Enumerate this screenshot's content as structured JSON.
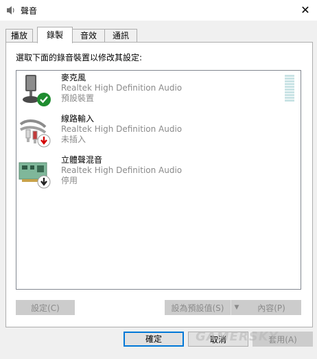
{
  "window": {
    "title": "聲音",
    "close_glyph": "✕"
  },
  "tabs": [
    {
      "label": "播放",
      "active": false
    },
    {
      "label": "錄製",
      "active": true
    },
    {
      "label": "音效",
      "active": false
    },
    {
      "label": "通訊",
      "active": false
    }
  ],
  "instruction": "選取下面的錄音裝置以修改其設定:",
  "devices": [
    {
      "name": "麥克風",
      "driver": "Realtek High Definition Audio",
      "status": "預設裝置",
      "icon": "microphone-icon",
      "badge": "default-check-icon"
    },
    {
      "name": "線路輸入",
      "driver": "Realtek High Definition Audio",
      "status": "未插入",
      "icon": "line-in-cable-icon",
      "badge": "unplugged-arrow-icon"
    },
    {
      "name": "立體聲混音",
      "driver": "Realtek High Definition Audio",
      "status": "停用",
      "icon": "sound-card-icon",
      "badge": "disabled-arrow-icon"
    }
  ],
  "buttons": {
    "configure": "設定(C)",
    "set_default": "設為預設值(S)",
    "properties": "內容(P)",
    "ok": "確定",
    "cancel": "取消",
    "apply": "套用(A)"
  },
  "watermark": "GAMERSKY",
  "colors": {
    "accent": "#0078d7",
    "check_green": "#1e8c2f",
    "arrow_red": "#d40000"
  }
}
